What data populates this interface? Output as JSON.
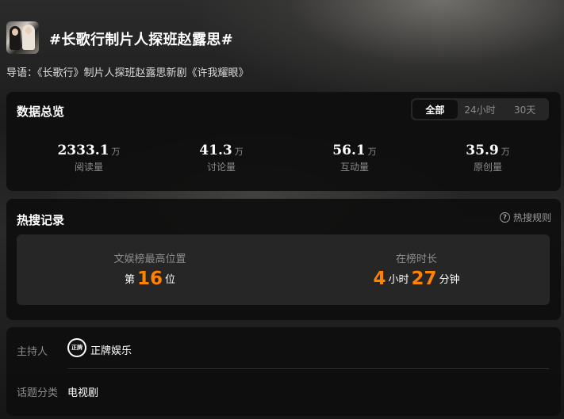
{
  "topic": {
    "title": "#长歌行制片人探班赵露思#",
    "intro_label": "导语：",
    "intro_text": "《长歌行》制片人探班赵露思新剧《许我耀眼》"
  },
  "overview": {
    "title": "数据总览",
    "tabs": [
      {
        "label": "全部",
        "active": true
      },
      {
        "label": "24小时",
        "active": false
      },
      {
        "label": "30天",
        "active": false
      }
    ],
    "stats": [
      {
        "value": "2333.1",
        "unit": "万",
        "label": "阅读量"
      },
      {
        "value": "41.3",
        "unit": "万",
        "label": "讨论量"
      },
      {
        "value": "56.1",
        "unit": "万",
        "label": "互动量"
      },
      {
        "value": "35.9",
        "unit": "万",
        "label": "原创量"
      }
    ]
  },
  "hot_search": {
    "title": "热搜记录",
    "rules_label": "热搜规则",
    "rules_icon": "question-circle-icon",
    "best_rank": {
      "label": "文娱榜最高位置",
      "prefix": "第",
      "value": "16",
      "suffix": "位"
    },
    "duration": {
      "label": "在榜时长",
      "hours": "4",
      "hours_unit": "小时",
      "minutes": "27",
      "minutes_unit": "分钟"
    },
    "highlight_color": "#ff8200"
  },
  "info": {
    "host_label": "主持人",
    "host_name": "正牌娱乐",
    "host_logo_text": "正牌",
    "category_label": "话题分类",
    "category_value": "电视剧"
  }
}
